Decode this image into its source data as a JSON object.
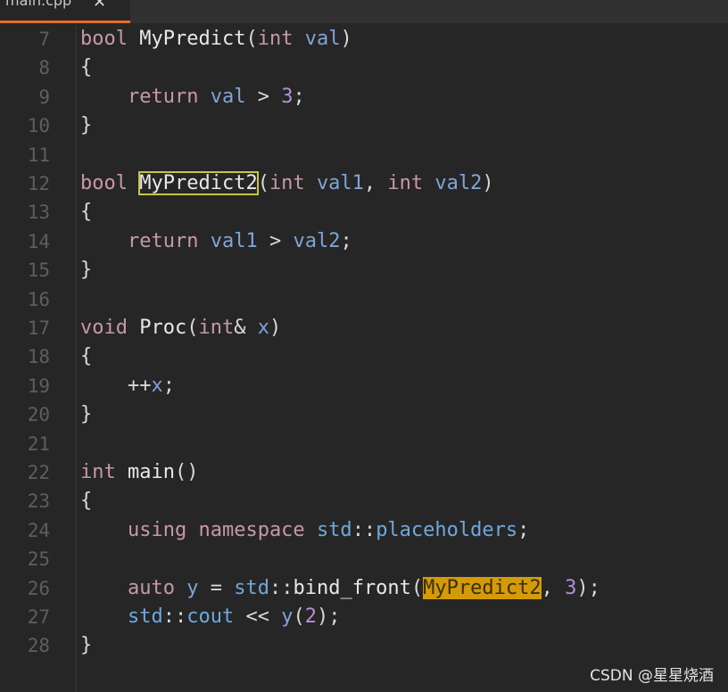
{
  "tab": {
    "label": "main.cpp",
    "close": "✕"
  },
  "lines": [
    {
      "n": "7",
      "tokens": [
        [
          "ty",
          "bool"
        ],
        [
          "p",
          " "
        ],
        [
          "fn",
          "MyPredict"
        ],
        [
          "p",
          "("
        ],
        [
          "ty",
          "int"
        ],
        [
          "p",
          " "
        ],
        [
          "var",
          "val"
        ],
        [
          "p",
          ")"
        ]
      ]
    },
    {
      "n": "8",
      "tokens": [
        [
          "p",
          "{"
        ]
      ]
    },
    {
      "n": "9",
      "tokens": [
        [
          "p",
          "    "
        ],
        [
          "kw",
          "return"
        ],
        [
          "p",
          " "
        ],
        [
          "var",
          "val"
        ],
        [
          "p",
          " > "
        ],
        [
          "num",
          "3"
        ],
        [
          "p",
          ";"
        ]
      ]
    },
    {
      "n": "10",
      "tokens": [
        [
          "p",
          "}"
        ]
      ]
    },
    {
      "n": "11",
      "tokens": []
    },
    {
      "n": "12",
      "tokens": [
        [
          "ty",
          "bool"
        ],
        [
          "p",
          " "
        ],
        [
          "sel",
          "MyPredict2"
        ],
        [
          "p",
          "("
        ],
        [
          "ty",
          "int"
        ],
        [
          "p",
          " "
        ],
        [
          "var",
          "val1"
        ],
        [
          "p",
          ", "
        ],
        [
          "ty",
          "int"
        ],
        [
          "p",
          " "
        ],
        [
          "var",
          "val2"
        ],
        [
          "p",
          ")"
        ]
      ]
    },
    {
      "n": "13",
      "tokens": [
        [
          "p",
          "{"
        ]
      ]
    },
    {
      "n": "14",
      "tokens": [
        [
          "p",
          "    "
        ],
        [
          "kw",
          "return"
        ],
        [
          "p",
          " "
        ],
        [
          "var",
          "val1"
        ],
        [
          "p",
          " > "
        ],
        [
          "var",
          "val2"
        ],
        [
          "p",
          ";"
        ]
      ]
    },
    {
      "n": "15",
      "tokens": [
        [
          "p",
          "}"
        ]
      ]
    },
    {
      "n": "16",
      "tokens": []
    },
    {
      "n": "17",
      "tokens": [
        [
          "ty",
          "void"
        ],
        [
          "p",
          " "
        ],
        [
          "fn",
          "Proc"
        ],
        [
          "p",
          "("
        ],
        [
          "ty",
          "int"
        ],
        [
          "p",
          "& "
        ],
        [
          "var",
          "x"
        ],
        [
          "p",
          ")"
        ]
      ]
    },
    {
      "n": "18",
      "tokens": [
        [
          "p",
          "{"
        ]
      ]
    },
    {
      "n": "19",
      "tokens": [
        [
          "p",
          "    ++"
        ],
        [
          "var",
          "x"
        ],
        [
          "p",
          ";"
        ]
      ]
    },
    {
      "n": "20",
      "tokens": [
        [
          "p",
          "}"
        ]
      ]
    },
    {
      "n": "21",
      "tokens": []
    },
    {
      "n": "22",
      "tokens": [
        [
          "ty",
          "int"
        ],
        [
          "p",
          " "
        ],
        [
          "fn",
          "main"
        ],
        [
          "p",
          "()"
        ]
      ]
    },
    {
      "n": "23",
      "tokens": [
        [
          "p",
          "{"
        ]
      ]
    },
    {
      "n": "24",
      "tokens": [
        [
          "p",
          "    "
        ],
        [
          "kw",
          "using"
        ],
        [
          "p",
          " "
        ],
        [
          "kw",
          "namespace"
        ],
        [
          "p",
          " "
        ],
        [
          "ns",
          "std"
        ],
        [
          "p",
          "::"
        ],
        [
          "ns",
          "placeholders"
        ],
        [
          "p",
          ";"
        ]
      ]
    },
    {
      "n": "25",
      "tokens": []
    },
    {
      "n": "26",
      "tokens": [
        [
          "p",
          "    "
        ],
        [
          "kw",
          "auto"
        ],
        [
          "p",
          " "
        ],
        [
          "var",
          "y"
        ],
        [
          "p",
          " = "
        ],
        [
          "ns",
          "std"
        ],
        [
          "p",
          "::"
        ],
        [
          "fn",
          "bind_front"
        ],
        [
          "p",
          "("
        ],
        [
          "hl",
          "MyPredict2"
        ],
        [
          "p",
          ", "
        ],
        [
          "num",
          "3"
        ],
        [
          "p",
          ");"
        ]
      ]
    },
    {
      "n": "27",
      "tokens": [
        [
          "p",
          "    "
        ],
        [
          "ns",
          "std"
        ],
        [
          "p",
          "::"
        ],
        [
          "ns",
          "cout"
        ],
        [
          "p",
          " << "
        ],
        [
          "var",
          "y"
        ],
        [
          "p",
          "("
        ],
        [
          "num",
          "2"
        ],
        [
          "p",
          ");"
        ]
      ]
    },
    {
      "n": "28",
      "tokens": [
        [
          "p",
          "}"
        ]
      ]
    }
  ],
  "watermark": "CSDN @星星烧酒"
}
